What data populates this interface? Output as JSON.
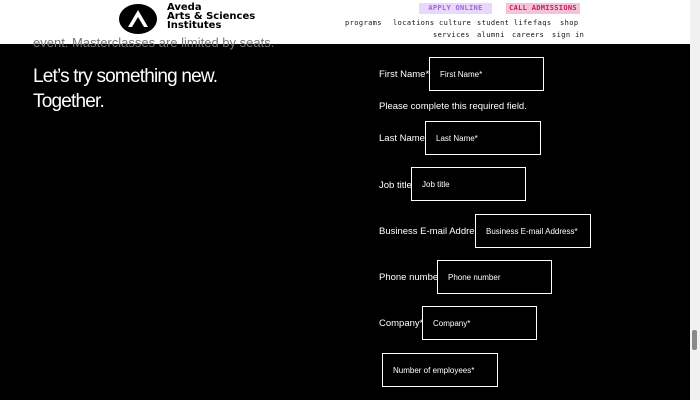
{
  "header": {
    "brand": {
      "line1": "Aveda",
      "line2": "Arts & Sciences",
      "line3": "Institutes"
    },
    "cta": {
      "apply": "APPLY ONLINE",
      "call": "CALL ADMISSIONS"
    },
    "nav_top": [
      "programs",
      "locations",
      "culture",
      "student life",
      "faqs",
      "shop"
    ],
    "nav_bottom": [
      "services",
      "alumni",
      "careers",
      "sign in"
    ]
  },
  "intro": {
    "clipped_text": "event. Masterclasses are limited by seats.",
    "headline_line1": "Let’s try something new.",
    "headline_line2": "Together."
  },
  "form": {
    "error": "Please complete this required field.",
    "fields": [
      {
        "label": "First Name*",
        "placeholder": "First Name*"
      },
      {
        "label": "Last Name*",
        "placeholder": "Last Name*"
      },
      {
        "label": "Job title",
        "placeholder": "Job title"
      },
      {
        "label": "Business E-mail Address*",
        "placeholder": "Business E-mail Address*"
      },
      {
        "label": "Phone number",
        "placeholder": "Phone number"
      },
      {
        "label": "Company*",
        "placeholder": "Company*"
      },
      {
        "label": "",
        "placeholder": "Number of employees*"
      }
    ]
  },
  "colors": {
    "background": "#000000",
    "apply_bg": "#e8d8fb",
    "call_bg": "#f5c3d8",
    "call_text": "#c81b55"
  }
}
